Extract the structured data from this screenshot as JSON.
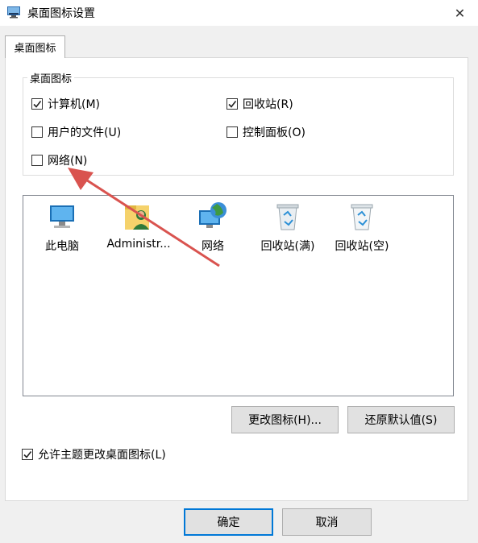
{
  "window": {
    "title": "桌面图标设置",
    "close_glyph": "✕"
  },
  "tabs": [
    {
      "label": "桌面图标",
      "active": true
    }
  ],
  "group": {
    "legend": "桌面图标",
    "checkboxes": [
      {
        "label": "计算机(M)",
        "checked": true
      },
      {
        "label": "回收站(R)",
        "checked": true
      },
      {
        "label": "用户的文件(U)",
        "checked": false
      },
      {
        "label": "控制面板(O)",
        "checked": false
      },
      {
        "label": "网络(N)",
        "checked": false
      }
    ]
  },
  "icons": [
    {
      "label": "此电脑",
      "icon": "computer-icon"
    },
    {
      "label": "Administr...",
      "icon": "user-folder-icon"
    },
    {
      "label": "网络",
      "icon": "network-icon"
    },
    {
      "label": "回收站(满)",
      "icon": "recycle-bin-full-icon"
    },
    {
      "label": "回收站(空)",
      "icon": "recycle-bin-empty-icon"
    }
  ],
  "buttons": {
    "change_icon": "更改图标(H)...",
    "restore_default": "还原默认值(S)",
    "ok": "确定",
    "cancel": "取消"
  },
  "allow_themes": {
    "label": "允许主题更改桌面图标(L)",
    "checked": true
  },
  "colors": {
    "accent": "#0078d7",
    "annotation_arrow": "#d9534f"
  }
}
